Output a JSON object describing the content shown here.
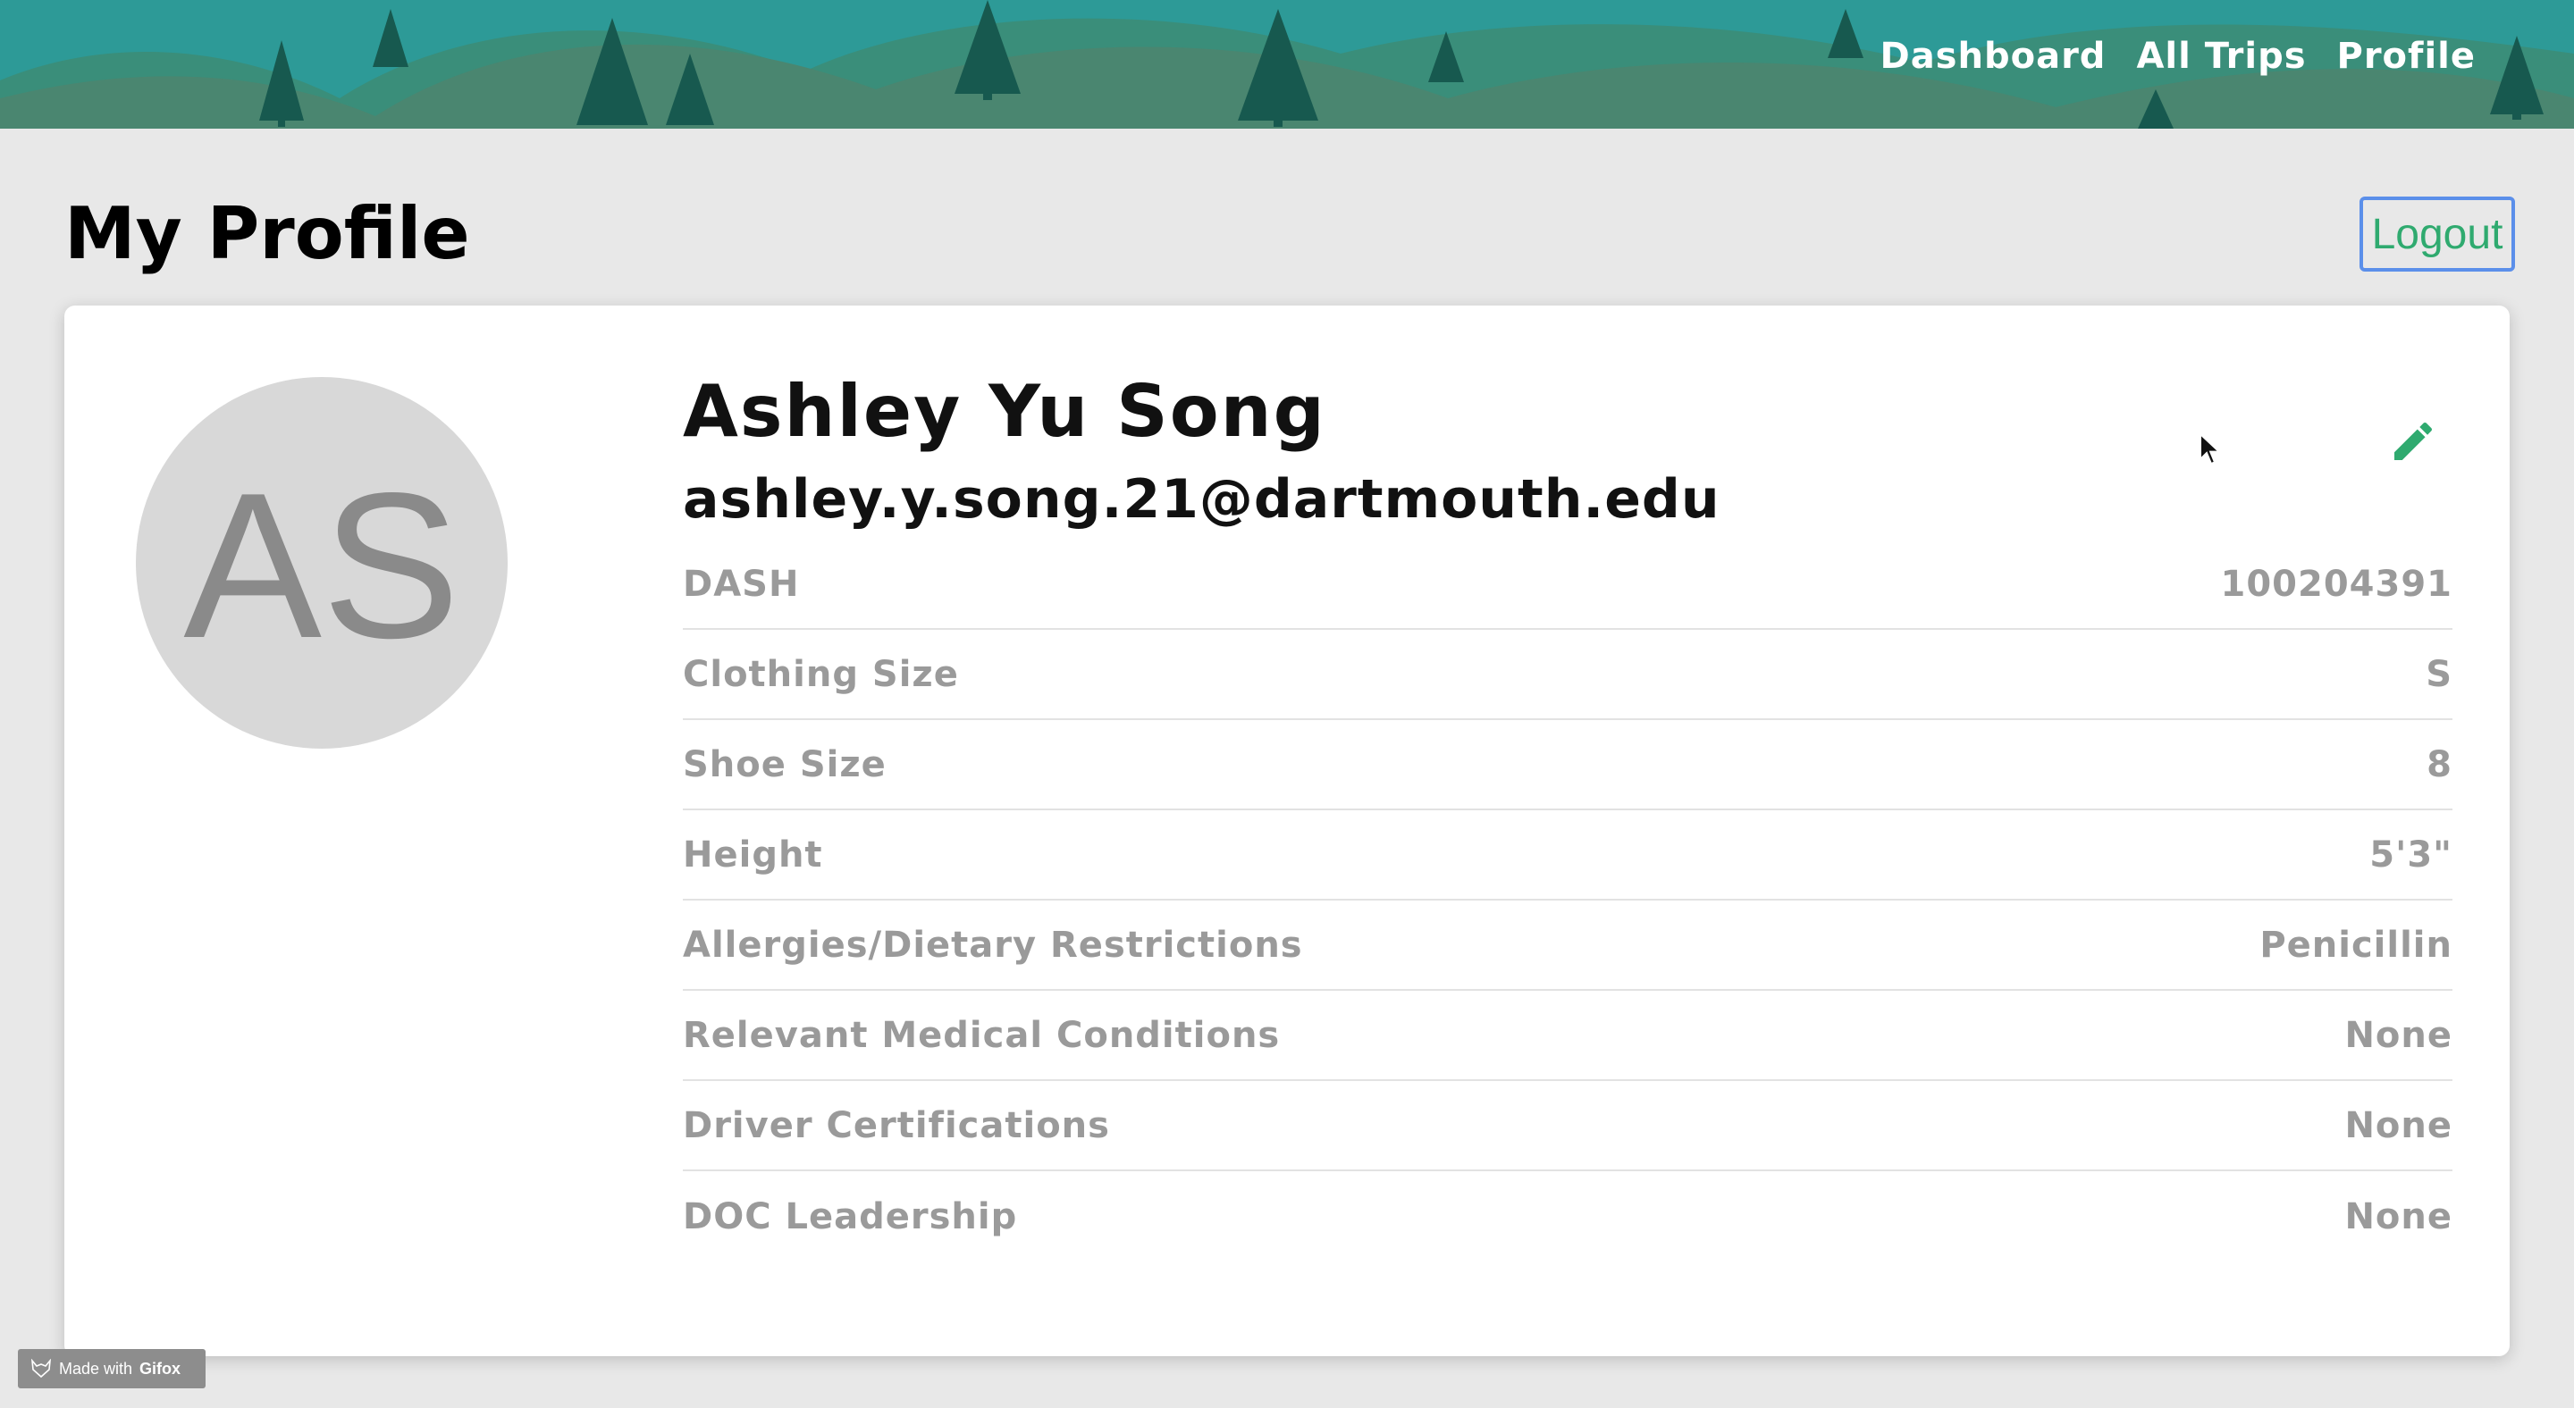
{
  "nav": {
    "items": [
      {
        "label": "Dashboard"
      },
      {
        "label": "All Trips"
      },
      {
        "label": "Profile"
      }
    ]
  },
  "page": {
    "title": "My Profile",
    "logout_label": "Logout"
  },
  "profile": {
    "initials": "AS",
    "name": "Ashley Yu Song",
    "email": "ashley.y.song.21@dartmouth.edu",
    "edit_icon": "pencil-icon",
    "fields": [
      {
        "label": "DASH",
        "value": "100204391"
      },
      {
        "label": "Clothing Size",
        "value": "S"
      },
      {
        "label": "Shoe Size",
        "value": "8"
      },
      {
        "label": "Height",
        "value": "5'3\""
      },
      {
        "label": "Allergies/Dietary Restrictions",
        "value": "Penicillin"
      },
      {
        "label": "Relevant Medical Conditions",
        "value": "None"
      },
      {
        "label": "Driver Certifications",
        "value": "None"
      },
      {
        "label": "DOC Leadership",
        "value": "None"
      }
    ]
  },
  "badge": {
    "prefix": "Made with",
    "brand": "Gifox"
  },
  "colors": {
    "banner_sky": "#2d9a97",
    "hill_light": "#3a8e7a",
    "hill_dark": "#4a8670",
    "tree": "#17594f",
    "accent_green": "#2faa6f",
    "focus_blue": "#5b8fea",
    "page_bg": "#e8e8e8",
    "muted_text": "#9a9a9a"
  }
}
